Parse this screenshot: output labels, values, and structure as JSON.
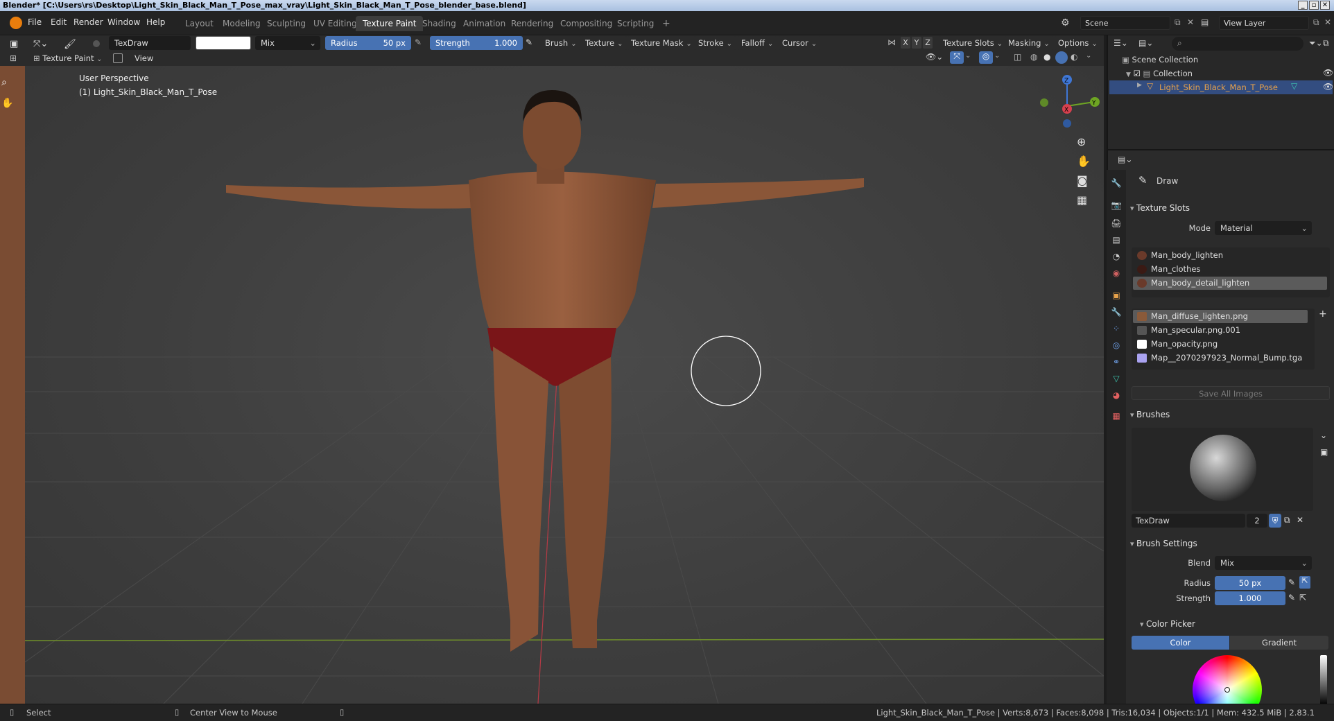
{
  "window": {
    "title": "Blender* [C:\\Users\\rs\\Desktop\\Light_Skin_Black_Man_T_Pose_max_vray\\Light_Skin_Black_Man_T_Pose_blender_base.blend]"
  },
  "menu": [
    "File",
    "Edit",
    "Render",
    "Window",
    "Help"
  ],
  "workspaces": [
    "Layout",
    "Modeling",
    "Sculpting",
    "UV Editing",
    "Texture Paint",
    "Shading",
    "Animation",
    "Rendering",
    "Compositing",
    "Scripting",
    "+"
  ],
  "active_workspace": "Texture Paint",
  "scene": {
    "name": "Scene",
    "view_layer": "View Layer"
  },
  "toolheader": {
    "brush_name": "TexDraw",
    "blend": "Mix",
    "radius_label": "Radius",
    "radius_value": "50 px",
    "strength_label": "Strength",
    "strength_value": "1.000",
    "menus": [
      "Brush",
      "Texture",
      "Texture Mask",
      "Stroke",
      "Falloff",
      "Cursor"
    ],
    "axes": [
      "X",
      "Y",
      "Z"
    ],
    "right_menus": [
      "Texture Slots",
      "Masking",
      "Options"
    ],
    "mode": "Texture Paint",
    "view": "View"
  },
  "viewport": {
    "perspective": "User Perspective",
    "object_label": "(1) Light_Skin_Black_Man_T_Pose",
    "gizmo_axes": [
      "Z",
      "Y",
      "X"
    ]
  },
  "outliner": {
    "root": "Scene Collection",
    "collection": "Collection",
    "object": "Light_Skin_Black_Man_T_Pose"
  },
  "properties": {
    "tool_name": "Draw",
    "texture_slots": {
      "title": "Texture Slots",
      "mode_label": "Mode",
      "mode_value": "Material",
      "materials": [
        {
          "name": "Man_body_lighten",
          "color": "#6a3a2a"
        },
        {
          "name": "Man_clothes",
          "color": "#3a1a14"
        },
        {
          "name": "Man_body_detail_lighten",
          "color": "#6a3a2a"
        }
      ],
      "selected_material": "Man_body_detail_lighten",
      "images": [
        {
          "name": "Man_diffuse_lighten.png",
          "color": "#8a5a3a"
        },
        {
          "name": "Man_specular.png.001",
          "color": "#555555"
        },
        {
          "name": "Man_opacity.png",
          "color": "#ffffff"
        },
        {
          "name": "Map__2070297923_Normal_Bump.tga",
          "color": "#a9a2f0"
        }
      ],
      "selected_image": "Man_diffuse_lighten.png",
      "save_all": "Save All Images"
    },
    "brushes": {
      "title": "Brushes",
      "brush_name": "TexDraw",
      "users": "2"
    },
    "brush_settings": {
      "title": "Brush Settings",
      "blend_label": "Blend",
      "blend_value": "Mix",
      "radius_label": "Radius",
      "radius_value": "50 px",
      "strength_label": "Strength",
      "strength_value": "1.000"
    },
    "color_picker": {
      "title": "Color Picker",
      "tabs": [
        "Color",
        "Gradient"
      ]
    }
  },
  "statusbar": {
    "select": "Select",
    "center_view": "Center View to Mouse",
    "stats": "Light_Skin_Black_Man_T_Pose | Verts:8,673 | Faces:8,098 | Tris:16,034 | Objects:1/1 | Mem: 432.5 MiB | 2.83.1"
  },
  "colors": {
    "accent": "#4772b3",
    "active_object": "#e8a24b",
    "header_bg": "#2b2b2b"
  }
}
